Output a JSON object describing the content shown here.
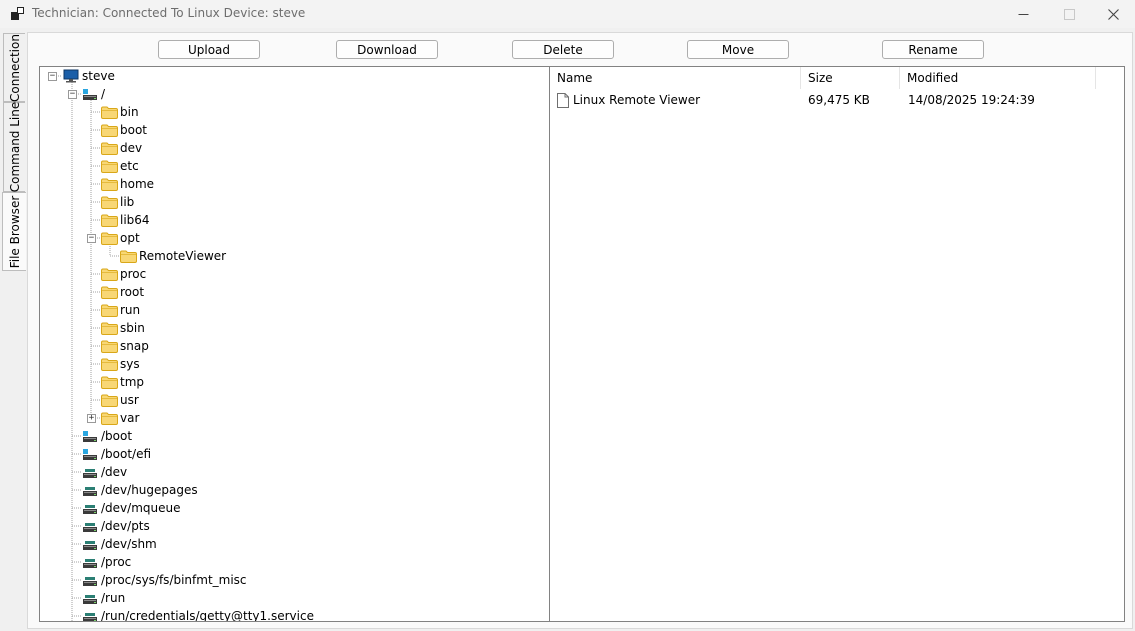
{
  "window": {
    "title": "Technician: Connected To Linux Device: steve",
    "controls": {
      "minimize": "minimize-icon",
      "maximize": "maximize-icon",
      "close": "close-icon"
    }
  },
  "side_tabs": [
    {
      "label": "Connection",
      "active": false
    },
    {
      "label": "Command Line",
      "active": false
    },
    {
      "label": "File Browser",
      "active": true
    }
  ],
  "toolbar": {
    "upload": "Upload",
    "download": "Download",
    "delete": "Delete",
    "move": "Move",
    "rename": "Rename"
  },
  "tree": {
    "root": {
      "label": "steve",
      "icon": "computer-icon",
      "expanded": true
    },
    "mount_root": {
      "label": "/",
      "icon": "drive-icon",
      "expanded": true
    },
    "root_folders": [
      {
        "label": "bin"
      },
      {
        "label": "boot"
      },
      {
        "label": "dev"
      },
      {
        "label": "etc"
      },
      {
        "label": "home"
      },
      {
        "label": "lib"
      },
      {
        "label": "lib64"
      },
      {
        "label": "opt",
        "expanded": true,
        "children": [
          {
            "label": "RemoteViewer"
          }
        ]
      },
      {
        "label": "proc"
      },
      {
        "label": "root"
      },
      {
        "label": "run"
      },
      {
        "label": "sbin"
      },
      {
        "label": "snap"
      },
      {
        "label": "sys"
      },
      {
        "label": "tmp"
      },
      {
        "label": "usr"
      },
      {
        "label": "var",
        "collapsed": true
      }
    ],
    "mounts": [
      {
        "label": "/boot",
        "icon": "drive-icon"
      },
      {
        "label": "/boot/efi",
        "icon": "drive-icon"
      },
      {
        "label": "/dev",
        "icon": "network-drive-icon"
      },
      {
        "label": "/dev/hugepages",
        "icon": "network-drive-icon"
      },
      {
        "label": "/dev/mqueue",
        "icon": "network-drive-icon"
      },
      {
        "label": "/dev/pts",
        "icon": "network-drive-icon"
      },
      {
        "label": "/dev/shm",
        "icon": "network-drive-icon"
      },
      {
        "label": "/proc",
        "icon": "network-drive-icon"
      },
      {
        "label": "/proc/sys/fs/binfmt_misc",
        "icon": "network-drive-icon"
      },
      {
        "label": "/run",
        "icon": "network-drive-icon"
      },
      {
        "label": "/run/credentials/getty@tty1.service",
        "icon": "network-drive-icon"
      }
    ]
  },
  "file_list": {
    "columns": {
      "name": "Name",
      "size": "Size",
      "modified": "Modified"
    },
    "rows": [
      {
        "name": "Linux Remote Viewer",
        "size": "69,475 KB",
        "modified": "14/08/2025 19:24:39",
        "icon": "file-icon"
      }
    ]
  },
  "colors": {
    "folder": "#f8d775",
    "folder_edge": "#d9a718",
    "computer": "#1a5ea8",
    "drive_accent": "#2aa6e0",
    "window_bg": "#f0f0f0"
  }
}
